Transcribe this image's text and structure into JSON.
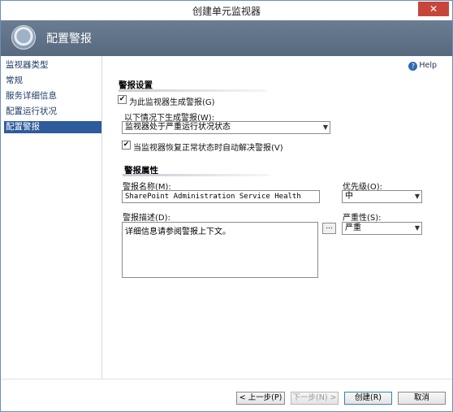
{
  "window": {
    "title": "创建单元监视器",
    "close_glyph": "✕"
  },
  "header": {
    "title": "配置警报",
    "logo_icon": "monitor-wizard-icon"
  },
  "nav": {
    "items": [
      {
        "label": "监视器类型",
        "active": false
      },
      {
        "label": "常规",
        "active": false
      },
      {
        "label": "服务详细信息",
        "active": false
      },
      {
        "label": "配置运行状况",
        "active": false
      },
      {
        "label": "配置警报",
        "active": true
      }
    ]
  },
  "help": {
    "label": "Help",
    "icon_glyph": "?"
  },
  "alert_settings": {
    "section_title": "警报设置",
    "generate_alerts_label": "为此监视器生成警报(G)",
    "generate_alerts_checked": true,
    "condition_label": "以下情况下生成警报(W):",
    "condition_value": "监视器处于严重运行状况状态",
    "auto_resolve_label": "当监视器恢复正常状态时自动解决警报(V)",
    "auto_resolve_checked": true
  },
  "alert_properties": {
    "section_title": "警报属性",
    "name_label": "警报名称(M):",
    "name_value": "SharePoint Administration Service Health",
    "priority_label": "优先级(O):",
    "priority_value": "中",
    "description_label": "警报描述(D):",
    "description_value": "详细信息请参阅警报上下文。",
    "ellipsis_label": "...",
    "severity_label": "严重性(S):",
    "severity_value": "严重"
  },
  "footer": {
    "prev_label": "< 上一步(P)",
    "next_label": "下一步(N) >",
    "create_label": "创建(R)",
    "cancel_label": "取消"
  },
  "check_glyph": "✔",
  "dropdown_glyph": "▼"
}
